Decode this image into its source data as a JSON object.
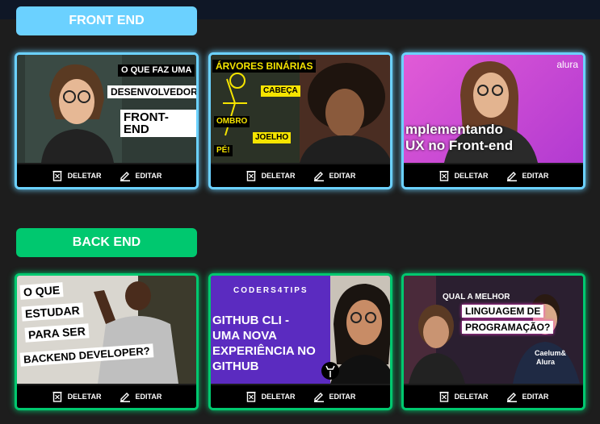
{
  "categories": [
    {
      "label": "FRONT END",
      "color": "#6bd1ff",
      "videos": [
        {
          "overlay": [
            "O QUE FAZ UMA",
            "DESENVOLVEDORA",
            "FRONT-END"
          ],
          "delete_label": "DELETAR",
          "edit_label": "EDITAR"
        },
        {
          "overlay": [
            "ÁRVORES BINÁRIAS",
            "CABEÇA",
            "OMBRO",
            "JOELHO",
            "PÉ!"
          ],
          "delete_label": "DELETAR",
          "edit_label": "EDITAR"
        },
        {
          "overlay": [
            "mplementando",
            "UX no Front-end"
          ],
          "brand": "alura",
          "delete_label": "DELETAR",
          "edit_label": "EDITAR"
        }
      ]
    },
    {
      "label": "BACK END",
      "color": "#00c86f",
      "videos": [
        {
          "overlay": [
            "O QUE",
            "ESTUDAR",
            "PARA SER",
            "BACKEND DEVELOPER?"
          ],
          "delete_label": "DELETAR",
          "edit_label": "EDITAR"
        },
        {
          "overlay": [
            "CODERS4TIPS",
            "GITHUB CLI -",
            "UMA NOVA",
            "EXPERIÊNCIA NO",
            "GITHUB"
          ],
          "delete_label": "DELETAR",
          "edit_label": "EDITAR"
        },
        {
          "overlay": [
            "QUAL A MELHOR",
            "LINGUAGEM DE",
            "PROGRAMAÇÃO?"
          ],
          "shirt": [
            "Caelum&",
            "Alura"
          ],
          "delete_label": "DELETAR",
          "edit_label": "EDITAR"
        }
      ]
    }
  ]
}
